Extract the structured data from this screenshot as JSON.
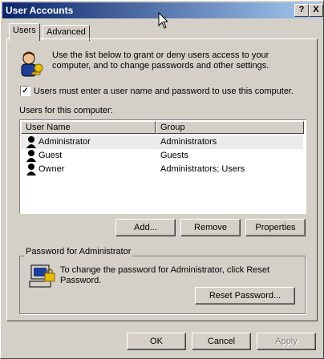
{
  "window": {
    "title": "User Accounts",
    "help_glyph": "?",
    "close_glyph": "X"
  },
  "tabs": [
    {
      "label": "Users",
      "active": true
    },
    {
      "label": "Advanced",
      "active": false
    }
  ],
  "intro": {
    "line1": "Use the list below to grant or deny users access to your",
    "line2": "computer, and to change passwords and other settings.",
    "icon": "users-key-icon"
  },
  "require_login": {
    "checked": true,
    "mark": "✓",
    "label": "Users must enter a user name and password to use this computer."
  },
  "users_list": {
    "caption": "Users for this computer:",
    "columns": [
      "User Name",
      "Group"
    ],
    "rows": [
      {
        "name": "Administrator",
        "group": "Administrators",
        "selected": true
      },
      {
        "name": "Guest",
        "group": "Guests",
        "selected": false
      },
      {
        "name": "Owner",
        "group": "Administrators; Users",
        "selected": false
      }
    ]
  },
  "list_buttons": {
    "add": "Add...",
    "remove": "Remove",
    "properties": "Properties"
  },
  "password_group": {
    "title": "Password for Administrator",
    "line1": "To change the password for Administrator, click Reset",
    "line2": "Password.",
    "reset_button": "Reset Password...",
    "icon": "computer-password-icon"
  },
  "dialog_buttons": {
    "ok": "OK",
    "cancel": "Cancel",
    "apply": "Apply",
    "apply_enabled": false
  },
  "colors": {
    "titlebar_start": "#0a246a",
    "titlebar_end": "#a6caf0",
    "face": "#d4d0c8"
  }
}
